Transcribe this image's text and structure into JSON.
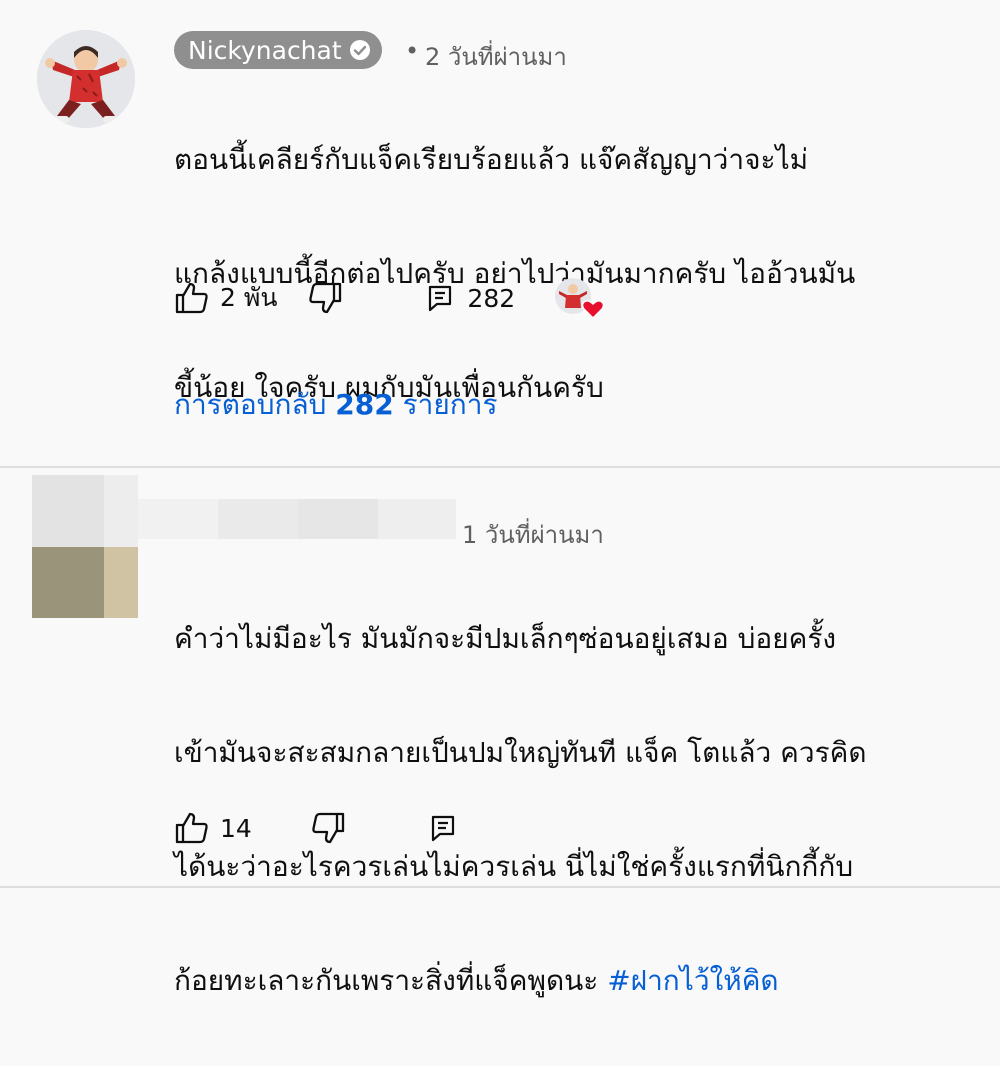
{
  "comments": [
    {
      "author": "Nickynachat",
      "verified": true,
      "separator": "•",
      "time": "2 วันที่ผ่านมา",
      "text_lines": [
        "ตอนนี้เคลียร์กับแจ็คเรียบร้อยแล้ว แจ๊คสัญญาว่าจะไม่",
        "แกล้งแบบนี้อีกต่อไปครับ อย่าไปว่ามันมากครับ ไออ้วนมัน",
        "ขี้น้อย ใจครับ ผมกับมันเพื่อนกันครับ"
      ],
      "likes": "2 พัน",
      "reply_count": "282",
      "replies_link": {
        "prefix": "การตอบกลับ ",
        "count": "282",
        "suffix": " รายการ"
      }
    },
    {
      "author": "",
      "time": "1 วันที่ผ่านมา",
      "text_lines": [
        "คำว่าไม่มีอะไร มันมักจะมีปมเล็กๆซ่อนอยู่เสมอ บ่อยครั้ง",
        "เข้ามันจะสะสมกลายเป็นปมใหญ่ทันที แจ็ค โตแล้ว ควรคิด",
        "ได้นะว่าอะไรควรเล่นไม่ควรเล่น นี่ไม่ใช่ครั้งแรกที่นิกกี้กับ"
      ],
      "last_line_text": "ก้อยทะเลาะกันเพราะสิ่งที่แจ็คพูดนะ ",
      "hashtag": "#ฝากไว้ให้คิด",
      "likes": "14"
    }
  ],
  "colors": {
    "link": "#065fd4",
    "heart": "#e8112d",
    "chip_bg": "#8f8f8f"
  }
}
